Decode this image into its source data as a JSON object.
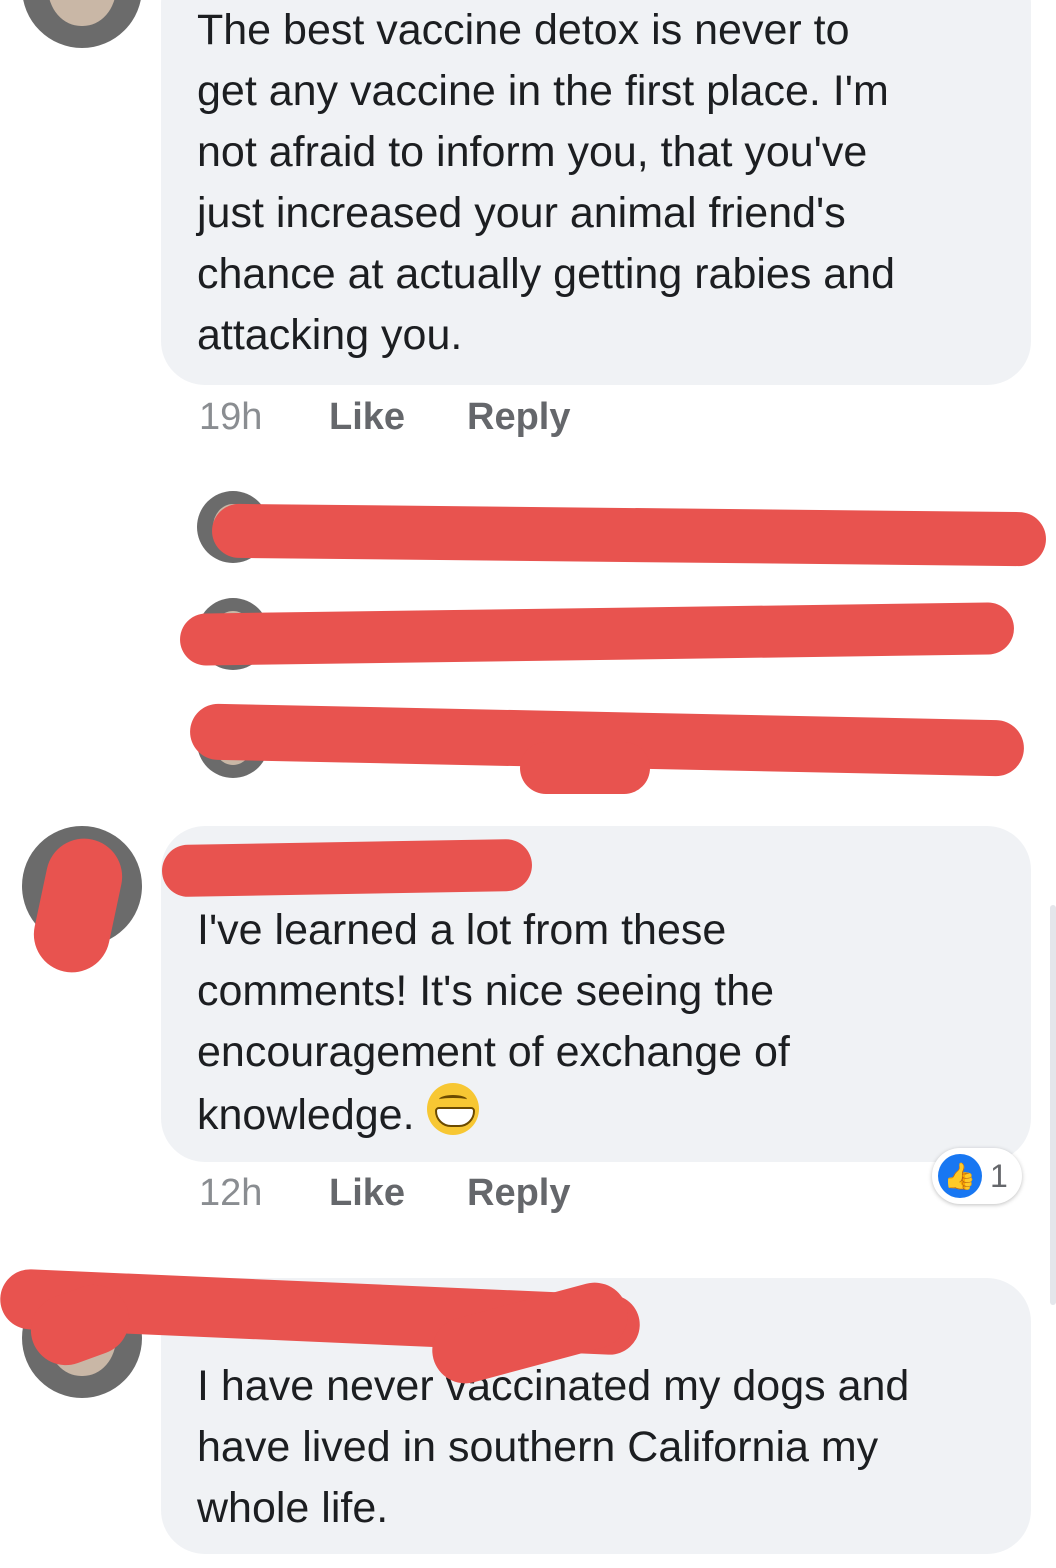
{
  "comments": [
    {
      "text": "The best vaccine detox is never to\nget any vaccine in the first place.  I'm\nnot afraid to inform you, that you've\njust increased your animal friend's\nchance at actually getting rabies and\nattacking you.",
      "time": "19h",
      "like_label": "Like",
      "reply_label": "Reply"
    },
    {
      "text": "I've learned a lot from these\ncomments! It's nice seeing the\nencouragement of exchange of\nknowledge.",
      "emoji": "grinning-face",
      "time": "12h",
      "like_label": "Like",
      "reply_label": "Reply",
      "reactions": {
        "icon": "like-icon",
        "count": "1"
      }
    },
    {
      "text": "I have never vaccinated my dogs and\nhave lived in southern California my\nwhole life."
    }
  ],
  "colors": {
    "bubble": "#f0f2f5",
    "redaction": "#e8534f",
    "like_blue": "#1877f2",
    "meta_text": "#65676b"
  }
}
